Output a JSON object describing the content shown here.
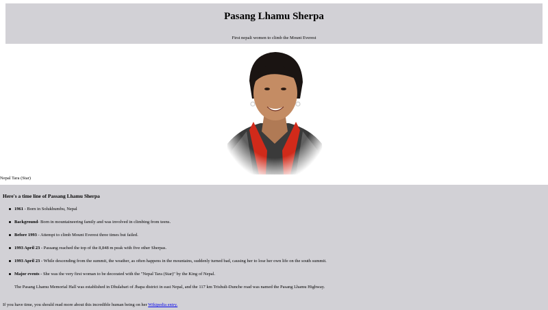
{
  "header": {
    "title": "Pasang Lhamu Sherpa",
    "subtitle": "First nepali women to climb the Mount Everest"
  },
  "portrait": {
    "caption": "Nepal Tara (Star)"
  },
  "timeline": {
    "heading": "Here's a time line of Passang Lhamu Sherpa",
    "items": [
      {
        "label": "1961",
        "text": " - Born in Solukhumbu, Nepal"
      },
      {
        "label": "Background",
        "text": "- Born in mountaineering family and was involved in climbing from teens."
      },
      {
        "label": "Before 1993",
        "text": " - Attempt to climb Mount Everest three times but failed."
      },
      {
        "label": "1993 April 23",
        "text": " - Passang reached the top of the 8,848 m peak with five other Sherpas."
      },
      {
        "label": "1993 April 23",
        "text": " - While descending from the summit, the weather, as often happens in the mountains, suddenly turned bad, causing her to lose her own life on the south summit."
      },
      {
        "label": "Major events",
        "text": " - She was the very first woman to be decorated with the \"Nepal Tara (Star)\" by the King of Nepal."
      }
    ],
    "memorial": "The Pasang Lhamu Memorial Hall was established in Dhulabari of Jhapa district in east Nepal, and the 117 km Trishuli-Dunche road was named the Pasang Lhamu Highway."
  },
  "footer": {
    "text": "If you have time, you should read more about this incredible human being on her ",
    "link_text": "Wikipedia entry."
  }
}
